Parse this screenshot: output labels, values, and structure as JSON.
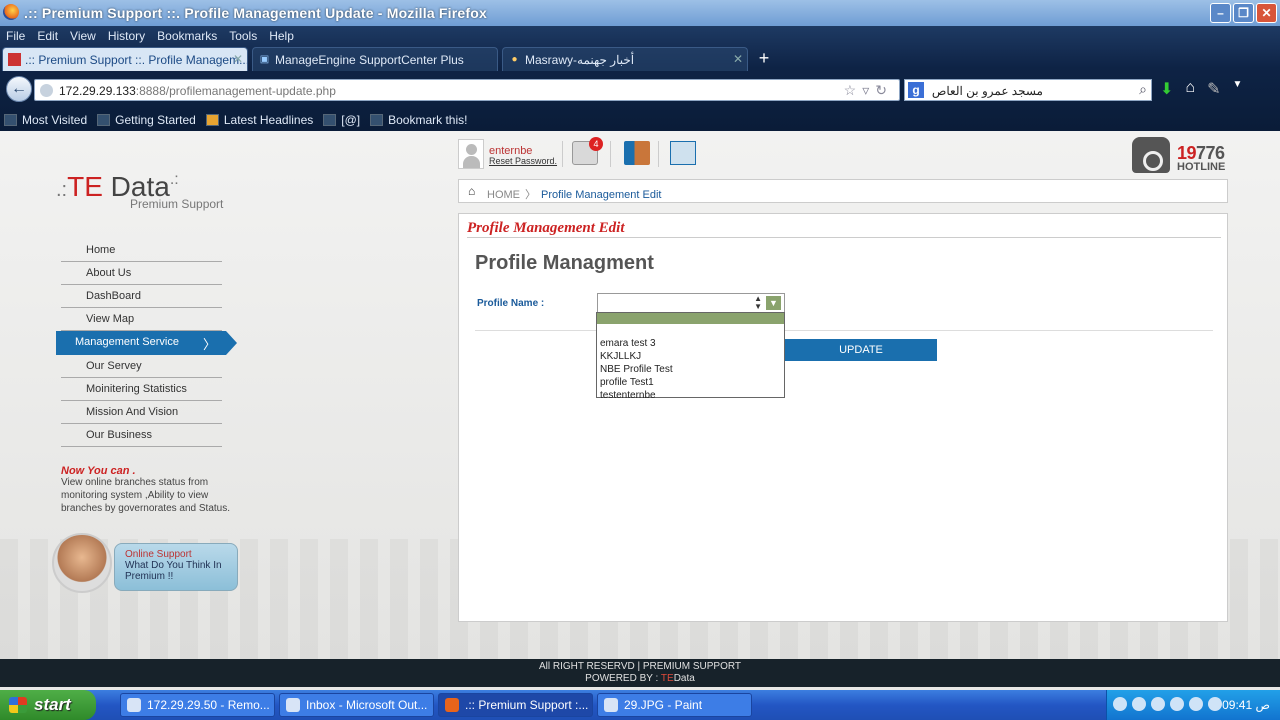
{
  "window": {
    "title": ".:: Premium Support ::. Profile Management Update - Mozilla Firefox",
    "controls": {
      "minimize": "–",
      "maximize": "❐",
      "close": "✕"
    }
  },
  "menu": [
    "File",
    "Edit",
    "View",
    "History",
    "Bookmarks",
    "Tools",
    "Help"
  ],
  "tabs": [
    {
      "label": ".:: Premium Support ::. Profile Managem...",
      "active": true
    },
    {
      "label": "ManageEngine SupportCenter Plus",
      "active": false
    },
    {
      "label": "Masrawy-أخبار جهنمه",
      "active": false
    }
  ],
  "newtab": "+",
  "address": {
    "host": "172.29.29.133",
    "rest": ":8888/profilemanagement-update.php"
  },
  "search": {
    "engine": "g",
    "value": "مسجد عمرو بن العاص"
  },
  "bookmarks": [
    "Most Visited",
    "Getting Started",
    "Latest Headlines",
    "[@]",
    "Bookmark this!"
  ],
  "logo": {
    "prefix": ".:",
    "brand": "TE",
    "name": " Data",
    "suffix": ".:",
    "tagline": "Premium Support"
  },
  "sidenav": [
    {
      "label": "Home",
      "active": false
    },
    {
      "label": "About Us",
      "active": false
    },
    {
      "label": "DashBoard",
      "active": false
    },
    {
      "label": "View Map",
      "active": false
    },
    {
      "label": "Management Service",
      "active": true
    },
    {
      "label": "Our Servey",
      "active": false
    },
    {
      "label": "Moinitering Statistics",
      "active": false
    },
    {
      "label": "Mission And Vision",
      "active": false
    },
    {
      "label": "Our Business",
      "active": false
    }
  ],
  "now_you_can": {
    "title": "Now You can .",
    "text": "View online branches status from monitoring system ,Ability to view branches by governorates and Status."
  },
  "online_support": {
    "title": "Online Support",
    "text": "What Do You Think In Premium !!"
  },
  "user": {
    "name": "enternbe",
    "reset": "Reset Password."
  },
  "messages_badge": "4",
  "hotline": {
    "prefix": "19",
    "number": "776",
    "label": "HOTLINE"
  },
  "breadcrumb": {
    "home": "HOME",
    "separator": "〉",
    "current": "Profile Management Edit"
  },
  "panel": {
    "title": "Profile Management Edit",
    "heading": "Profile Managment",
    "field_label": "Profile Name :",
    "button": "UPDATE"
  },
  "dropdown_options": [
    "emara test 3",
    "KKJLLKJ",
    "NBE Profile Test",
    "profile Test1",
    "testenternbe"
  ],
  "footer": {
    "line1": "All RIGHT RESERVD | PREMIUM SUPPORT",
    "line2_prefix": "POWERED BY : ",
    "te": "TE",
    "data": "Data"
  },
  "taskbar": {
    "start": "start",
    "tasks": [
      {
        "label": "172.29.29.50 - Remo..."
      },
      {
        "label": "Inbox - Microsoft Out..."
      },
      {
        "label": ".:: Premium Support :..."
      },
      {
        "label": "29.JPG - Paint"
      }
    ],
    "clock": "09:41 ص"
  },
  "colors": {
    "accent_blue": "#1a6fae",
    "brand_red": "#cc2222",
    "dropdown_highlight": "#8aa36d"
  }
}
